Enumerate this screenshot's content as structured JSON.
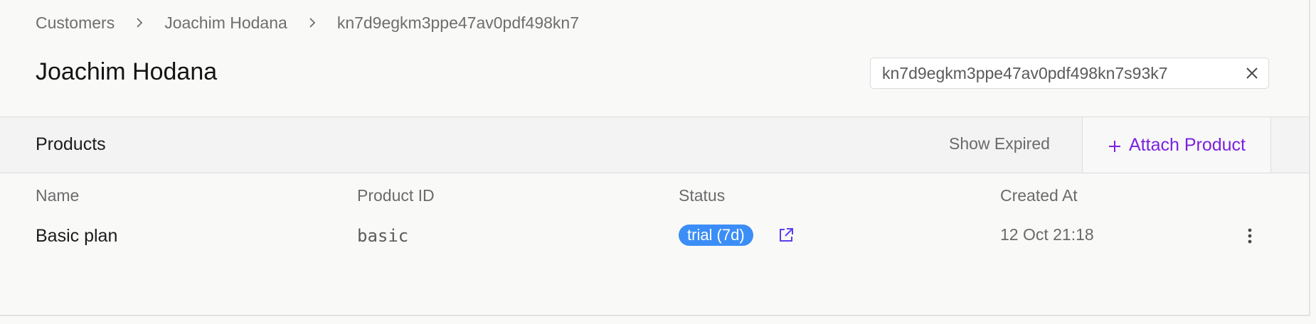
{
  "breadcrumb": {
    "items": [
      "Customers",
      "Joachim Hodana",
      "kn7d9egkm3ppe47av0pdf498kn7"
    ]
  },
  "page": {
    "title": "Joachim Hodana"
  },
  "search": {
    "value": "kn7d9egkm3ppe47av0pdf498kn7s93k7"
  },
  "products": {
    "title": "Products",
    "show_expired_label": "Show Expired",
    "attach_label": "Attach Product",
    "columns": [
      "Name",
      "Product ID",
      "Status",
      "Created At"
    ],
    "rows": [
      {
        "name": "Basic plan",
        "product_id": "basic",
        "status": "trial (7d)",
        "created_at": "12 Oct 21:18"
      }
    ]
  },
  "colors": {
    "accent": "#7b22e0",
    "status_trial": "#3b8ef6",
    "link_icon": "#5b3ef0"
  },
  "icons": {
    "breadcrumb_separator": "chevron-right-icon",
    "search_clear": "close-icon",
    "attach": "plus-icon",
    "status_link": "external-link-icon",
    "row_menu": "more-vertical-icon"
  }
}
